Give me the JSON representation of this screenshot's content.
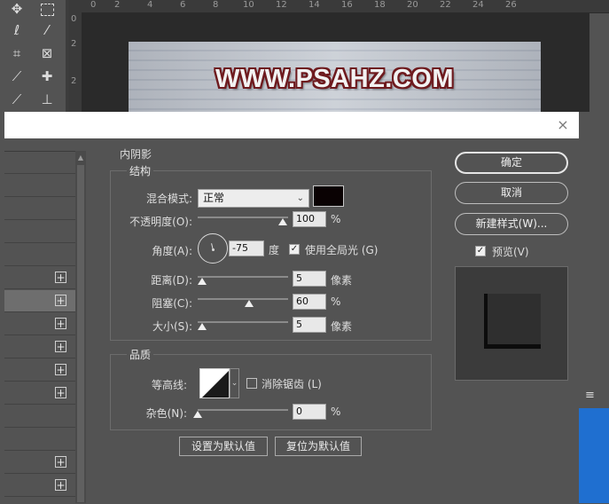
{
  "canvas": {
    "text": "WWW.PSAHZ.COM",
    "ruler_numbers": [
      "0",
      "2",
      "4",
      "6",
      "8",
      "10",
      "12",
      "14",
      "16",
      "18",
      "20",
      "22",
      "24",
      "26"
    ],
    "ruler_v_numbers": [
      "0",
      "2",
      "2"
    ]
  },
  "tools": [
    "move-icon",
    "marquee-icon",
    "lasso-icon",
    "magic-wand-icon",
    "crop-icon",
    "frame-icon",
    "eyedropper-icon",
    "healing-brush-icon",
    "brush-icon",
    "stamp-icon"
  ],
  "dialog": {
    "close": "×",
    "section_title": "内阴影",
    "structure": {
      "legend": "结构",
      "blend_mode_label": "混合模式:",
      "blend_mode_value": "正常",
      "shadow_color": "#0a0203",
      "opacity_label": "不透明度(O):",
      "opacity_value": "100",
      "opacity_fraction": 1.0,
      "percent": "%",
      "angle_label": "角度(A):",
      "angle_value": "-75",
      "angle_unit": "度",
      "global_light_label": "使用全局光 (G)",
      "global_light_checked": true,
      "distance_label": "距离(D):",
      "distance_value": "5",
      "distance_unit": "像素",
      "choke_label": "阻塞(C):",
      "choke_value": "60",
      "choke_unit": "%",
      "size_label": "大小(S):",
      "size_value": "5",
      "size_unit": "像素"
    },
    "quality": {
      "legend": "品质",
      "contour_label": "等高线:",
      "anti_alias_label": "消除锯齿 (L)",
      "anti_alias_checked": false,
      "noise_label": "杂色(N):",
      "noise_value": "0",
      "noise_unit": "%"
    },
    "buttons": {
      "make_default": "设置为默认值",
      "reset_default": "复位为默认值",
      "ok": "确定",
      "cancel": "取消",
      "new_style": "新建样式(W)...",
      "preview_label": "预览(V)",
      "preview_checked": true
    },
    "style_list": {
      "selected_index": 6,
      "plus": "+"
    }
  },
  "panel_menu_icon": "≡"
}
